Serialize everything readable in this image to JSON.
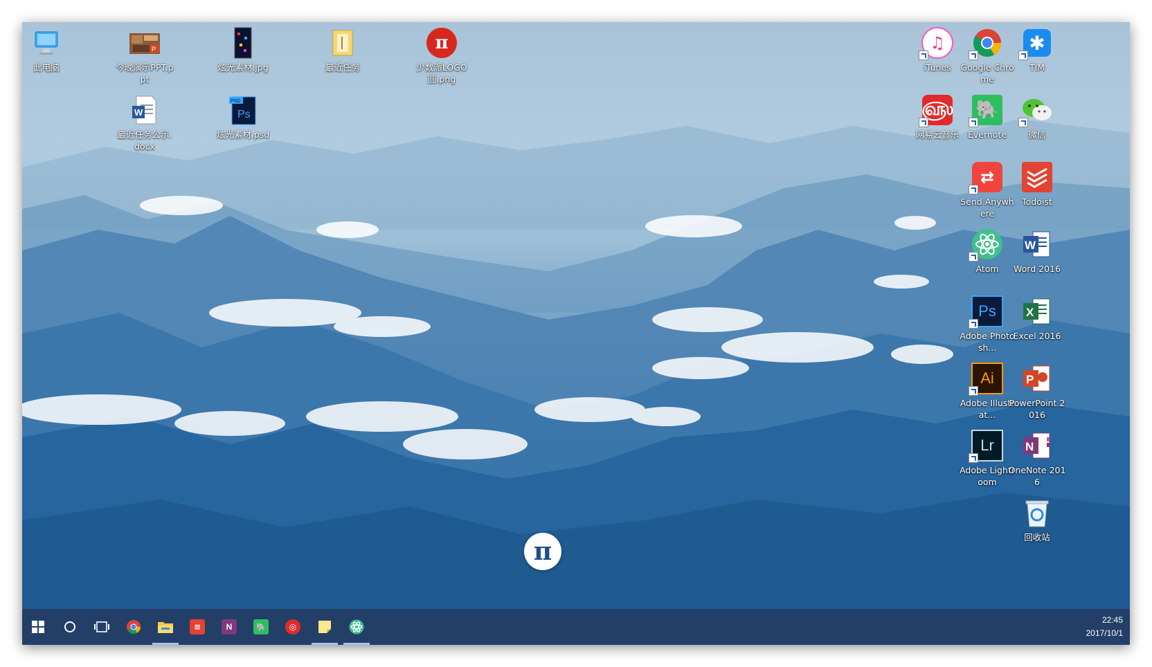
{
  "desktop": {
    "left_icons": [
      {
        "label": "此电脑",
        "icon": "computer-icon"
      },
      {
        "label": "今晚演示PPT.ppt",
        "icon": "ppt-file-icon"
      },
      {
        "label": "炫光素材.jpg",
        "icon": "image-file-icon"
      },
      {
        "label": "最近任务",
        "icon": "folder-icon"
      },
      {
        "label": "少数派LOGO圆.png",
        "icon": "sspai-logo-icon"
      },
      {
        "label": "最近任务公示.docx",
        "icon": "docx-file-icon"
      },
      {
        "label": "炫光素材.psd",
        "icon": "psd-file-icon"
      }
    ],
    "right_icons": [
      {
        "label": "iTunes",
        "icon": "itunes-icon"
      },
      {
        "label": "Google Chrome",
        "icon": "chrome-icon"
      },
      {
        "label": "TIM",
        "icon": "tim-icon"
      },
      {
        "label": "网易云音乐",
        "icon": "netease-music-icon"
      },
      {
        "label": "Evernote",
        "icon": "evernote-icon"
      },
      {
        "label": "微信",
        "icon": "wechat-icon"
      },
      {
        "label": "Send Anywhere",
        "icon": "send-anywhere-icon"
      },
      {
        "label": "Todoist",
        "icon": "todoist-icon"
      },
      {
        "label": "Atom",
        "icon": "atom-icon"
      },
      {
        "label": "Word 2016",
        "icon": "word-icon"
      },
      {
        "label": "Adobe Photosh...",
        "icon": "photoshop-icon"
      },
      {
        "label": "Excel 2016",
        "icon": "excel-icon"
      },
      {
        "label": "Adobe Illustrat...",
        "icon": "illustrator-icon"
      },
      {
        "label": "PowerPoint 2016",
        "icon": "powerpoint-icon"
      },
      {
        "label": "Adobe Lightroom",
        "icon": "lightroom-icon"
      },
      {
        "label": "OneNote 2016",
        "icon": "onenote-icon"
      },
      {
        "label": "回收站",
        "icon": "recycle-bin-icon"
      }
    ],
    "wallpaper_logo": "π"
  },
  "taskbar": {
    "items": [
      {
        "name": "start-button",
        "icon": "windows-icon"
      },
      {
        "name": "cortana-button",
        "icon": "cortana-circle-icon"
      },
      {
        "name": "task-view-button",
        "icon": "task-view-icon"
      },
      {
        "name": "taskbar-chrome",
        "icon": "chrome-icon"
      },
      {
        "name": "taskbar-file-explorer",
        "icon": "folder-icon",
        "active": true
      },
      {
        "name": "taskbar-todoist",
        "icon": "todoist-icon"
      },
      {
        "name": "taskbar-onenote",
        "icon": "onenote-icon"
      },
      {
        "name": "taskbar-evernote",
        "icon": "evernote-icon"
      },
      {
        "name": "taskbar-netease-music",
        "icon": "netease-music-icon"
      },
      {
        "name": "taskbar-sticky-notes",
        "icon": "sticky-notes-icon",
        "active": true
      },
      {
        "name": "taskbar-atom",
        "icon": "atom-icon",
        "active": true
      }
    ],
    "clock": {
      "time": "22:45",
      "date": "2017/10/1"
    }
  },
  "colors": {
    "taskbar": "#233f67",
    "accent": "#9fc3f0"
  }
}
